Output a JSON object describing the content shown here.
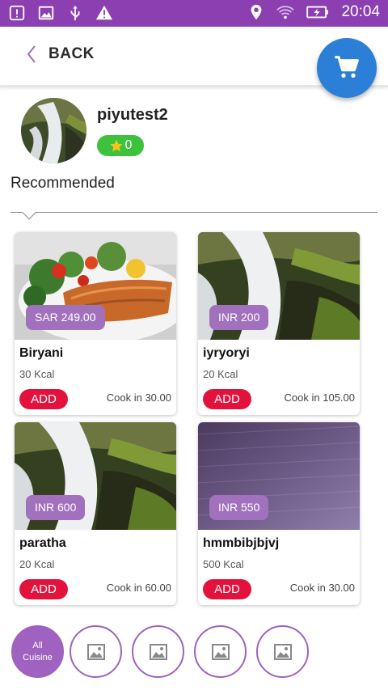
{
  "statusbar": {
    "time": "20:04",
    "left_icons": [
      "alert-box-icon",
      "image-icon",
      "usb-icon",
      "warning-icon"
    ],
    "right_icons": [
      "location-pin-icon",
      "wifi-icon",
      "battery-charging-icon"
    ],
    "color": "#8b3fb0"
  },
  "header": {
    "back_label": "BACK",
    "cart_color": "#2b7fd6"
  },
  "profile": {
    "name": "piyutest2",
    "rating": "0",
    "rating_color": "#3cc23c"
  },
  "section": {
    "title": "Recommended"
  },
  "items": [
    {
      "price": "SAR 249.00",
      "name": "Biryani",
      "kcal": "30 Kcal",
      "add_label": "ADD",
      "cook": "Cook in 30.00",
      "image": "salmon-plate"
    },
    {
      "price": "INR 200",
      "name": "iyryoryi",
      "kcal": "20 Kcal",
      "add_label": "ADD",
      "cook": "Cook in 105.00",
      "image": "waterfall"
    },
    {
      "price": "INR 600",
      "name": "paratha",
      "kcal": "20 Kcal",
      "add_label": "ADD",
      "cook": "Cook in 60.00",
      "image": "waterfall"
    },
    {
      "price": "INR 550",
      "name": "hmmbibjbjvj",
      "kcal": "500 Kcal",
      "add_label": "ADD",
      "cook": "Cook in 30.00",
      "image": "purple-texture"
    }
  ],
  "cuisines": {
    "active_label_1": "All",
    "active_label_2": "Cuisine",
    "others": [
      "image-placeholder-icon",
      "image-placeholder-icon",
      "image-placeholder-icon",
      "image-placeholder-icon"
    ]
  },
  "colors": {
    "accent": "#a062c0",
    "add_button": "#e3123d",
    "price_badge": "#a271bd"
  }
}
